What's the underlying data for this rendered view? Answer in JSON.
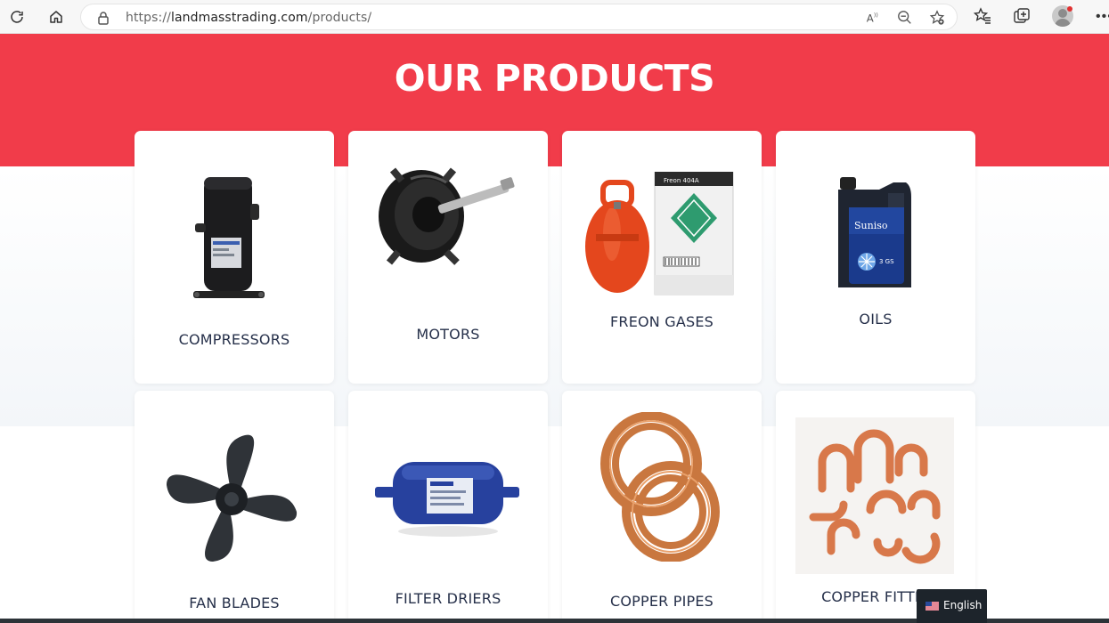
{
  "browser": {
    "url_prefix": "https://",
    "url_domain": "landmasstrading.com",
    "url_path": "/products/"
  },
  "page": {
    "heading": "OUR PRODUCTS",
    "products": [
      {
        "label": "COMPRESSORS",
        "icon": "compressor-image"
      },
      {
        "label": "MOTORS",
        "icon": "motor-image"
      },
      {
        "label": "FREON GASES",
        "icon": "freon-gas-image"
      },
      {
        "label": "OILS",
        "icon": "oil-bottle-image"
      },
      {
        "label": "FAN BLADES",
        "icon": "fan-blade-image"
      },
      {
        "label": "FILTER DRIERS",
        "icon": "filter-drier-image"
      },
      {
        "label": "COPPER PIPES",
        "icon": "copper-pipe-image"
      },
      {
        "label": "COPPER FITTIN",
        "icon": "copper-fitting-image"
      }
    ]
  },
  "image_text": {
    "freon_brand": "Freon 404A",
    "oil_brand": "Suniso",
    "oil_grade": "3 GS"
  },
  "language_switcher": {
    "label": "English"
  },
  "colors": {
    "hero_red": "#f13c4a",
    "label_navy": "#26304a"
  }
}
